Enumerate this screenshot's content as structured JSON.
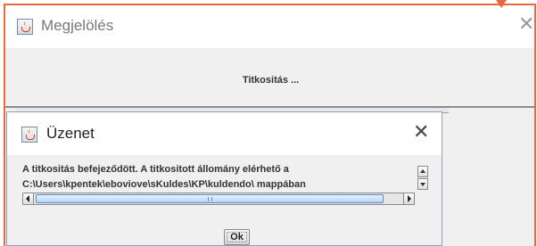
{
  "main_window": {
    "title": "Megjelölés",
    "center_label": "Titkositás ...",
    "icon": "java-icon",
    "close_icon": "close-icon"
  },
  "dialog": {
    "title": "Üzenet",
    "icon": "java-icon",
    "close_icon": "close-icon",
    "message_line1": "A titkositás befejeződött. A titkositott állomány elérhető a",
    "message_line2": "C:\\Users\\kpentek\\eboviove\\sKuldes\\KP\\kuldendo\\ mappában",
    "ok_label": "Ok"
  },
  "colors": {
    "highlight": "#e9683c",
    "window_bg": "#f0f0f0",
    "scroll_thumb": "#b8d3f3"
  }
}
